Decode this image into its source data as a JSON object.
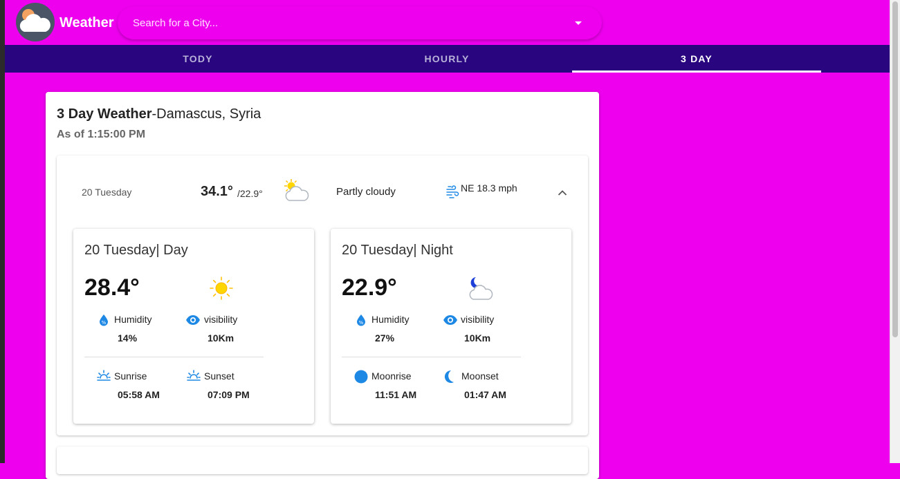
{
  "app": {
    "title": "Weather"
  },
  "search": {
    "placeholder": "Search for a City..."
  },
  "tabs": [
    {
      "label": "TODY",
      "active": false
    },
    {
      "label": "HOURLY",
      "active": false
    },
    {
      "label": "3 DAY",
      "active": true
    }
  ],
  "card": {
    "title_bold": "3 Day Weather",
    "title_rest": "-Damascus, Syria",
    "as_of": "As of 1:15:00 PM"
  },
  "summary": {
    "day": "20 Tuesday",
    "high": "34.1°",
    "low": "/22.9°",
    "condition": "Partly cloudy",
    "condition_icon": "partly-cloudy-icon",
    "wind": "NE 18.3 mph",
    "wind_icon": "wind-icon"
  },
  "day_panel": {
    "title": "20 Tuesday| Day",
    "temp": "28.4°",
    "icon": "sunny-icon",
    "humidity_label": "Humidity",
    "humidity": "14%",
    "visibility_label": "visibility",
    "visibility": "10Km",
    "sunrise_label": "Sunrise",
    "sunrise": "05:58 AM",
    "sunset_label": "Sunset",
    "sunset": "07:09 PM"
  },
  "night_panel": {
    "title": "20 Tuesday| Night",
    "temp": "22.9°",
    "icon": "partly-cloudy-night-icon",
    "humidity_label": "Humidity",
    "humidity": "27%",
    "visibility_label": "visibility",
    "visibility": "10Km",
    "moonrise_label": "Moonrise",
    "moonrise": "11:51 AM",
    "moonset_label": "Moonset",
    "moonset": "01:47 AM"
  },
  "colors": {
    "background": "#ee00ee",
    "tab_bar": "#2a0580",
    "accent_blue": "#1e88e5",
    "sun_yellow": "#ffd600"
  }
}
